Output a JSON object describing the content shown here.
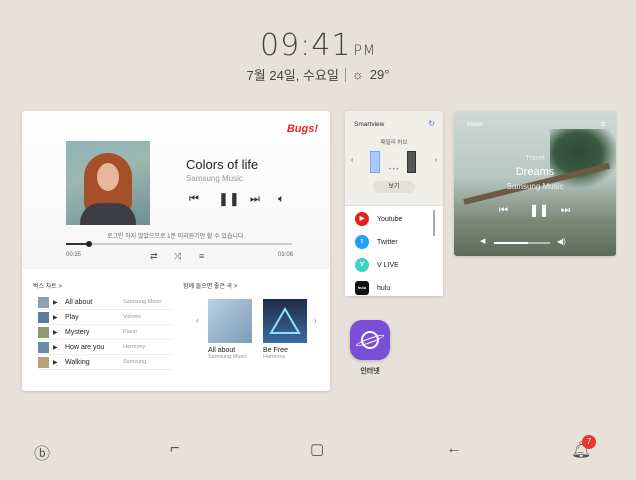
{
  "status": {
    "time": "09:41",
    "ampm": "PM",
    "date": "7월 24일, 수요일",
    "weather_icon": "sun-icon",
    "temperature": "29°"
  },
  "bugs": {
    "logo": "Bugs!",
    "song_title": "Colors of life",
    "artist": "Samsung Music",
    "notice": "로그인 하지 않았으므로 1분 미리듣기만 할 수 있습니다.",
    "elapsed": "00:35",
    "total": "03:06",
    "progress_fraction": 0.1,
    "chart_header": "벅스 차트 >",
    "recommend_header": "함께 들으면 좋은 곡 >",
    "chart": [
      {
        "title": "All about",
        "artist": "Samsung Music",
        "thumb": "#8aa0b3"
      },
      {
        "title": "Play",
        "artist": "Volume",
        "thumb": "#5e7a9a"
      },
      {
        "title": "Mystery",
        "artist": "Piano",
        "thumb": "#8c9a6d"
      },
      {
        "title": "How are you",
        "artist": "Harmony",
        "thumb": "#6d8aa6"
      },
      {
        "title": "Walking",
        "artist": "Samsung",
        "thumb": "#b6a17a"
      }
    ],
    "recommend": [
      {
        "title": "All about",
        "artist": "Samsung Music"
      },
      {
        "title": "Be Free",
        "artist": "Harmony"
      }
    ]
  },
  "smartview": {
    "title": "Smartview",
    "subtitle": "패밀리 허브",
    "button": "보기",
    "apps": [
      {
        "name": "Youtube",
        "color": "#e62117",
        "glyph": "▶"
      },
      {
        "name": "Twitter",
        "color": "#1da1f2",
        "glyph": "t"
      },
      {
        "name": "V LIVE",
        "color": "#3ed3c2",
        "glyph": "V"
      },
      {
        "name": "hulu",
        "color": "#111111",
        "glyph": "hulu"
      }
    ]
  },
  "melon": {
    "logo": "Melon",
    "subtitle": "Travel",
    "title": "Dreams",
    "artist": "Samsung Music",
    "volume_fraction": 0.6
  },
  "internet": {
    "label": "인터넷"
  },
  "navbar": {
    "notification_count": "7"
  }
}
